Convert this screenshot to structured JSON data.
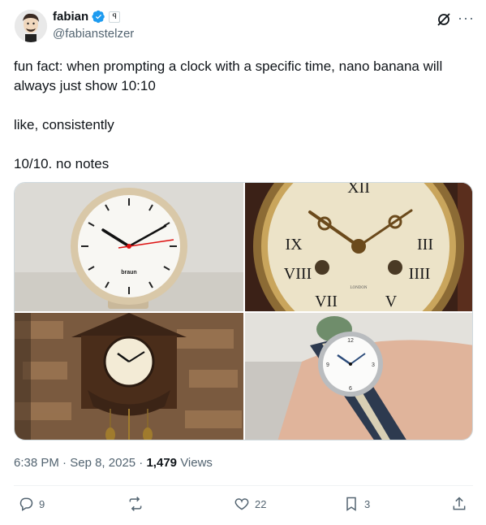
{
  "author": {
    "name": "fabian",
    "handle": "@fabianstelzer",
    "affiliate_badge": "ꟼ"
  },
  "tweet": {
    "paragraphs": [
      "fun fact: when prompting a clock with a specific time, nano banana will always just show 10:10",
      "like, consistently",
      "10/10. no notes"
    ]
  },
  "media": [
    {
      "desc_icon": "wall-clock-image",
      "brand_text": "braun"
    },
    {
      "desc_icon": "roman-clock-image",
      "label_text": "LONDON"
    },
    {
      "desc_icon": "cuckoo-clock-image"
    },
    {
      "desc_icon": "wristwatch-image"
    }
  ],
  "meta": {
    "time": "6:38 PM",
    "separator": "·",
    "date": "Sep 8, 2025",
    "views_count": "1,479",
    "views_label": "Views"
  },
  "actions": {
    "replies": "9",
    "reposts": "",
    "likes": "22",
    "bookmarks": "3"
  },
  "colors": {
    "verified": "#1d9bf0",
    "secondary_text": "#536471",
    "primary_text": "#0f1419"
  }
}
